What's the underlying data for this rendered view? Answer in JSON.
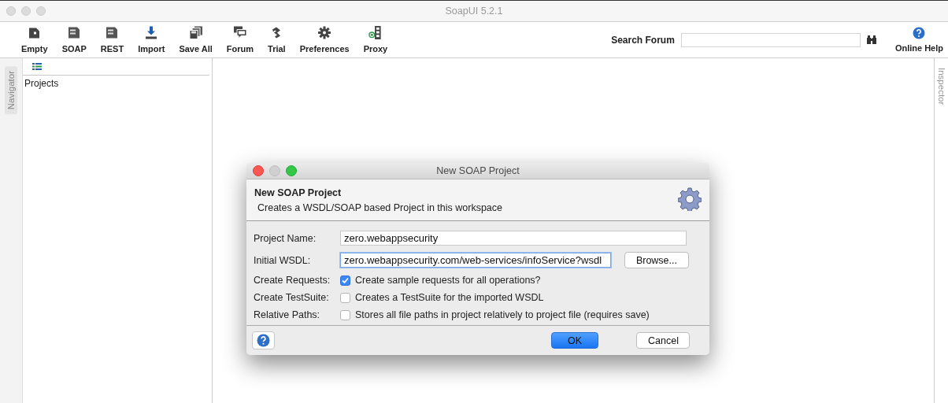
{
  "window": {
    "title": "SoapUI 5.2.1"
  },
  "toolbar": {
    "items": [
      {
        "label": "Empty"
      },
      {
        "label": "SOAP"
      },
      {
        "label": "REST"
      },
      {
        "label": "Import"
      },
      {
        "label": "Save All"
      },
      {
        "label": "Forum"
      },
      {
        "label": "Trial"
      },
      {
        "label": "Preferences"
      },
      {
        "label": "Proxy"
      }
    ],
    "search_label": "Search Forum",
    "help_label": "Online Help"
  },
  "navigator": {
    "tab": "Navigator",
    "tree_root": "Projects"
  },
  "inspector": {
    "tab": "Inspector"
  },
  "dialog": {
    "title": "New SOAP Project",
    "heading": "New SOAP Project",
    "description": "Creates a WSDL/SOAP based Project in this workspace",
    "fields": [
      {
        "label": "Project Name:",
        "value": "zero.webappsecurity",
        "focused": false
      },
      {
        "label": "Initial WSDL:",
        "value": "zero.webappsecurity.com/web-services/infoService?wsdl",
        "focused": true
      }
    ],
    "browse_button": "Browse...",
    "options": [
      {
        "label": "Create Requests:",
        "text": "Create sample requests for all operations?",
        "checked": true
      },
      {
        "label": "Create TestSuite:",
        "text": "Creates a TestSuite for the imported WSDL",
        "checked": false
      },
      {
        "label": "Relative Paths:",
        "text": "Stores all file paths in project relatively to project file (requires save)",
        "checked": false
      }
    ],
    "buttons": [
      {
        "label": "OK",
        "default": true
      },
      {
        "label": "Cancel",
        "default": false
      }
    ]
  }
}
